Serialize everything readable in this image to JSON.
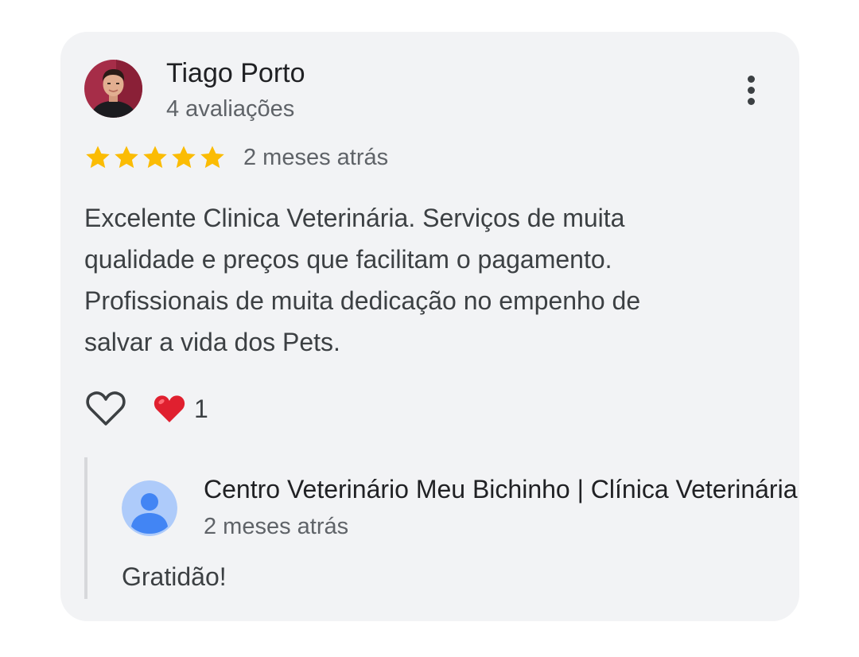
{
  "review": {
    "reviewer": {
      "name": "Tiago Porto",
      "meta": "4 avaliações",
      "avatar": "reviewer-photo"
    },
    "rating": 5,
    "rating_max": 5,
    "date": "2 meses atrás",
    "text_lines": [
      "Excelente Clinica Veterinária. Serviços de muita",
      "qualidade e preços que facilitam o pagamento.",
      "Profissionais de muita dedicação no empenho de",
      "salvar a vida dos Pets."
    ],
    "actions": {
      "like_icon": "heart-outline-icon",
      "reaction_icon": "red-heart-icon",
      "reaction_count": "1"
    },
    "menu_icon": "more-vertical-icon"
  },
  "owner_reply": {
    "name": "Centro Veterinário Meu Bichinho | Clínica Veterinária",
    "date": "2 meses atrás",
    "text": "Gratidão!",
    "avatar": "default-profile-icon"
  },
  "colors": {
    "card_background": "#f2f3f5",
    "star": "#fbbc04",
    "heart": "#e0202f",
    "reply_avatar": "#aecbfa",
    "reply_avatar_figure": "#4285f4"
  }
}
